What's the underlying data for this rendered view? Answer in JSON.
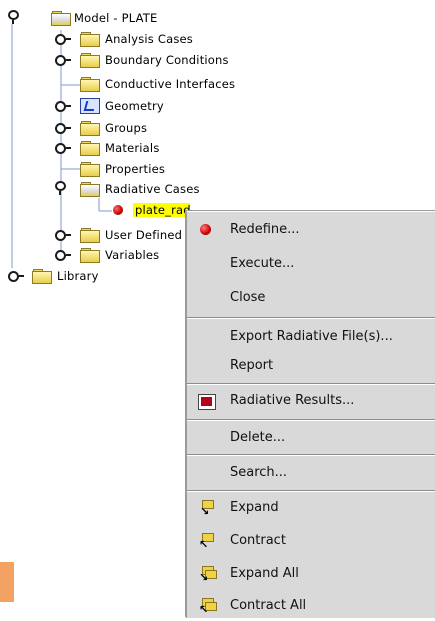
{
  "tree": {
    "root": {
      "label": "Model - PLATE"
    },
    "children": [
      {
        "label": "Analysis Cases"
      },
      {
        "label": "Boundary Conditions"
      },
      {
        "label": "Conductive Interfaces"
      },
      {
        "label": "Geometry"
      },
      {
        "label": "Groups"
      },
      {
        "label": "Materials"
      },
      {
        "label": "Properties"
      },
      {
        "label": "Radiative Cases"
      },
      {
        "label": "plate_rad"
      },
      {
        "label": "User Defined"
      },
      {
        "label": "Variables"
      }
    ],
    "library": {
      "label": "Library"
    }
  },
  "context_menu": {
    "items": [
      {
        "label": "Redefine...",
        "icon": "red-ball-icon"
      },
      {
        "label": "Execute..."
      },
      {
        "label": "Close"
      },
      {
        "label": "Export Radiative File(s)..."
      },
      {
        "label": "Report"
      },
      {
        "label": "Radiative Results...",
        "icon": "results-icon"
      },
      {
        "label": "Delete..."
      },
      {
        "label": "Search..."
      },
      {
        "label": "Expand",
        "icon": "expand-icon"
      },
      {
        "label": "Contract",
        "icon": "contract-icon"
      },
      {
        "label": "Expand All",
        "icon": "expand-all-icon"
      },
      {
        "label": "Contract All",
        "icon": "contract-all-icon"
      }
    ]
  },
  "colors": {
    "selection_highlight": "#ffff00",
    "menu_background": "#d9d9d9",
    "folder_yellow": "#efd860",
    "accent_orange": "#f4a263"
  }
}
